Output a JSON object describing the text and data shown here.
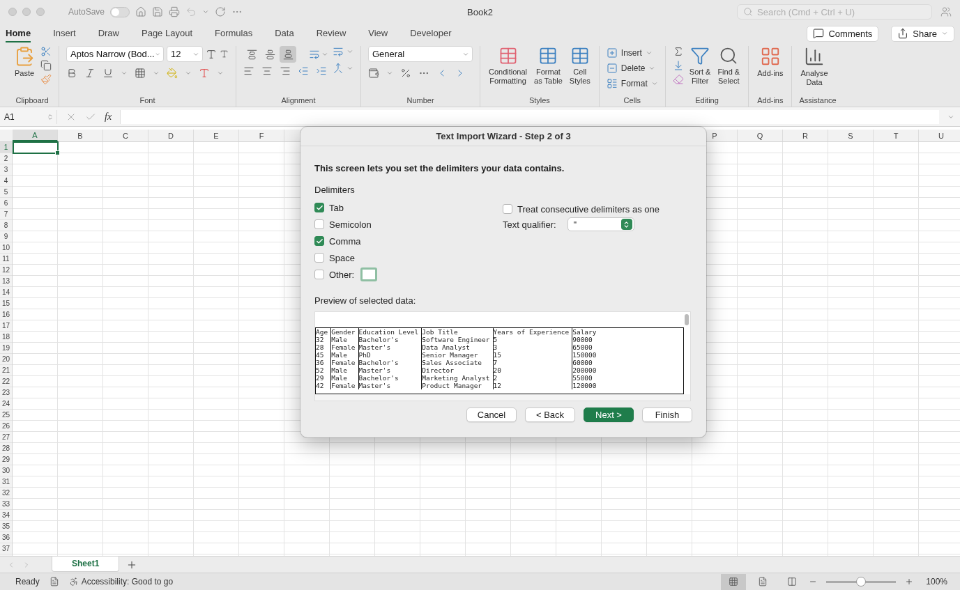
{
  "window": {
    "title": "Book2"
  },
  "titlebar": {
    "autosave_label": "AutoSave",
    "autosave_on": false,
    "search_placeholder": "Search (Cmd + Ctrl + U)"
  },
  "tabs": [
    {
      "label": "Home",
      "selected": true
    },
    {
      "label": "Insert",
      "selected": false
    },
    {
      "label": "Draw",
      "selected": false
    },
    {
      "label": "Page Layout",
      "selected": false
    },
    {
      "label": "Formulas",
      "selected": false
    },
    {
      "label": "Data",
      "selected": false
    },
    {
      "label": "Review",
      "selected": false
    },
    {
      "label": "View",
      "selected": false
    },
    {
      "label": "Developer",
      "selected": false
    }
  ],
  "actions": [
    {
      "label": "Comments",
      "kind": "comments"
    },
    {
      "label": "Share",
      "kind": "share"
    }
  ],
  "ribbon": [
    {
      "kind": "clipboard",
      "label": "Clipboard",
      "button": "Paste"
    },
    {
      "kind": "font",
      "label": "Font",
      "font_name": "Aptos Narrow (Bod...",
      "font_size": "12"
    },
    {
      "kind": "alignment",
      "label": "Alignment",
      "vertical_align": [
        {
          "selected": false
        },
        {
          "selected": false
        },
        {
          "selected": true
        }
      ]
    },
    {
      "kind": "number",
      "label": "Number",
      "format": "General"
    },
    {
      "kind": "styles",
      "label": "Styles",
      "buttons": [
        [
          "Conditional",
          "Formatting"
        ],
        [
          "Format",
          "as Table"
        ],
        [
          "Cell",
          "Styles"
        ]
      ]
    },
    {
      "kind": "cells",
      "label": "Cells",
      "buttons": [
        "Insert",
        "Delete",
        "Format"
      ]
    },
    {
      "kind": "editing",
      "label": "Editing",
      "buttons": [
        [
          "Sort &",
          "Filter"
        ],
        [
          "Find &",
          "Select"
        ]
      ]
    },
    {
      "kind": "addins",
      "label": "Add-ins",
      "buttons": [
        [
          "Add-ins"
        ]
      ]
    },
    {
      "kind": "assistance",
      "label": "Assistance",
      "buttons": [
        [
          "Analyse",
          "Data"
        ]
      ]
    }
  ],
  "formula_bar": {
    "name_box": "A1",
    "function_label": "fx"
  },
  "columns": {
    "left": [
      {
        "label": "A",
        "selected": true
      },
      {
        "label": "B",
        "selected": false
      },
      {
        "label": "C",
        "selected": false
      },
      {
        "label": "D",
        "selected": false
      },
      {
        "label": "E",
        "selected": false
      },
      {
        "label": "F",
        "selected": false
      }
    ],
    "right": [
      {
        "label": "P",
        "selected": false
      },
      {
        "label": "Q",
        "selected": false
      },
      {
        "label": "R",
        "selected": false
      },
      {
        "label": "S",
        "selected": false
      },
      {
        "label": "T",
        "selected": false
      },
      {
        "label": "U",
        "selected": false
      }
    ]
  },
  "rows": [
    {
      "label": "1",
      "selected": true
    },
    {
      "label": "2",
      "selected": false
    },
    {
      "label": "3",
      "selected": false
    },
    {
      "label": "4",
      "selected": false
    },
    {
      "label": "5",
      "selected": false
    },
    {
      "label": "6",
      "selected": false
    },
    {
      "label": "7",
      "selected": false
    },
    {
      "label": "8",
      "selected": false
    },
    {
      "label": "9",
      "selected": false
    },
    {
      "label": "10",
      "selected": false
    },
    {
      "label": "11",
      "selected": false
    },
    {
      "label": "12",
      "selected": false
    },
    {
      "label": "13",
      "selected": false
    },
    {
      "label": "14",
      "selected": false
    },
    {
      "label": "15",
      "selected": false
    },
    {
      "label": "16",
      "selected": false
    },
    {
      "label": "17",
      "selected": false
    },
    {
      "label": "18",
      "selected": false
    },
    {
      "label": "19",
      "selected": false
    },
    {
      "label": "20",
      "selected": false
    },
    {
      "label": "21",
      "selected": false
    },
    {
      "label": "22",
      "selected": false
    },
    {
      "label": "23",
      "selected": false
    },
    {
      "label": "24",
      "selected": false
    },
    {
      "label": "25",
      "selected": false
    },
    {
      "label": "26",
      "selected": false
    },
    {
      "label": "27",
      "selected": false
    },
    {
      "label": "28",
      "selected": false
    },
    {
      "label": "29",
      "selected": false
    },
    {
      "label": "30",
      "selected": false
    },
    {
      "label": "31",
      "selected": false
    },
    {
      "label": "32",
      "selected": false
    },
    {
      "label": "33",
      "selected": false
    },
    {
      "label": "34",
      "selected": false
    },
    {
      "label": "35",
      "selected": false
    },
    {
      "label": "36",
      "selected": false
    },
    {
      "label": "37",
      "selected": false
    }
  ],
  "sheet_tabs": [
    {
      "label": "Sheet1",
      "selected": true
    }
  ],
  "status_bar": {
    "ready": "Ready",
    "accessibility": "Accessibility: Good to go",
    "views": [
      {
        "selected": true
      },
      {
        "selected": false
      },
      {
        "selected": false
      }
    ],
    "level": 0.5,
    "zoom": "100%"
  },
  "dialog": {
    "title": "Text Import Wizard - Step 2 of 3",
    "intro": "This screen lets you set the delimiters your data contains.",
    "delimiters_label": "Delimiters",
    "delimiters": [
      {
        "label": "Tab",
        "checked": true,
        "kind": "plain"
      },
      {
        "label": "Semicolon",
        "checked": false,
        "kind": "plain"
      },
      {
        "label": "Comma",
        "checked": true,
        "kind": "plain"
      },
      {
        "label": "Space",
        "checked": false,
        "kind": "plain"
      },
      {
        "label": "Other:",
        "checked": false,
        "kind": "other",
        "focused": true
      }
    ],
    "consecutive": {
      "label": "Treat consecutive delimiters as one",
      "checked": false
    },
    "qualifier": {
      "label": "Text qualifier:",
      "value": "\""
    },
    "preview_label": "Preview of selected data:",
    "preview": {
      "columns": [
        "Age",
        "Gender",
        "Education Level",
        "Job Title",
        "Years of Experience",
        "Salary"
      ],
      "rows": [
        [
          "32",
          "Male",
          "Bachelor's",
          "Software Engineer",
          "5",
          "90000"
        ],
        [
          "28",
          "Female",
          "Master's",
          "Data Analyst",
          "3",
          "65000"
        ],
        [
          "45",
          "Male",
          "PhD",
          "Senior Manager",
          "15",
          "150000"
        ],
        [
          "36",
          "Female",
          "Bachelor's",
          "Sales Associate",
          "7",
          "60000"
        ],
        [
          "52",
          "Male",
          "Master's",
          "Director",
          "20",
          "200000"
        ],
        [
          "29",
          "Male",
          "Bachelor's",
          "Marketing Analyst",
          "2",
          "55000"
        ],
        [
          "42",
          "Female",
          "Master's",
          "Product Manager",
          "12",
          "120000"
        ]
      ]
    },
    "buttons": [
      {
        "label": "Cancel",
        "kind": "default"
      },
      {
        "label": "< Back",
        "kind": "default"
      },
      {
        "label": "Next >",
        "kind": "primary"
      },
      {
        "label": "Finish",
        "kind": "default"
      }
    ]
  }
}
